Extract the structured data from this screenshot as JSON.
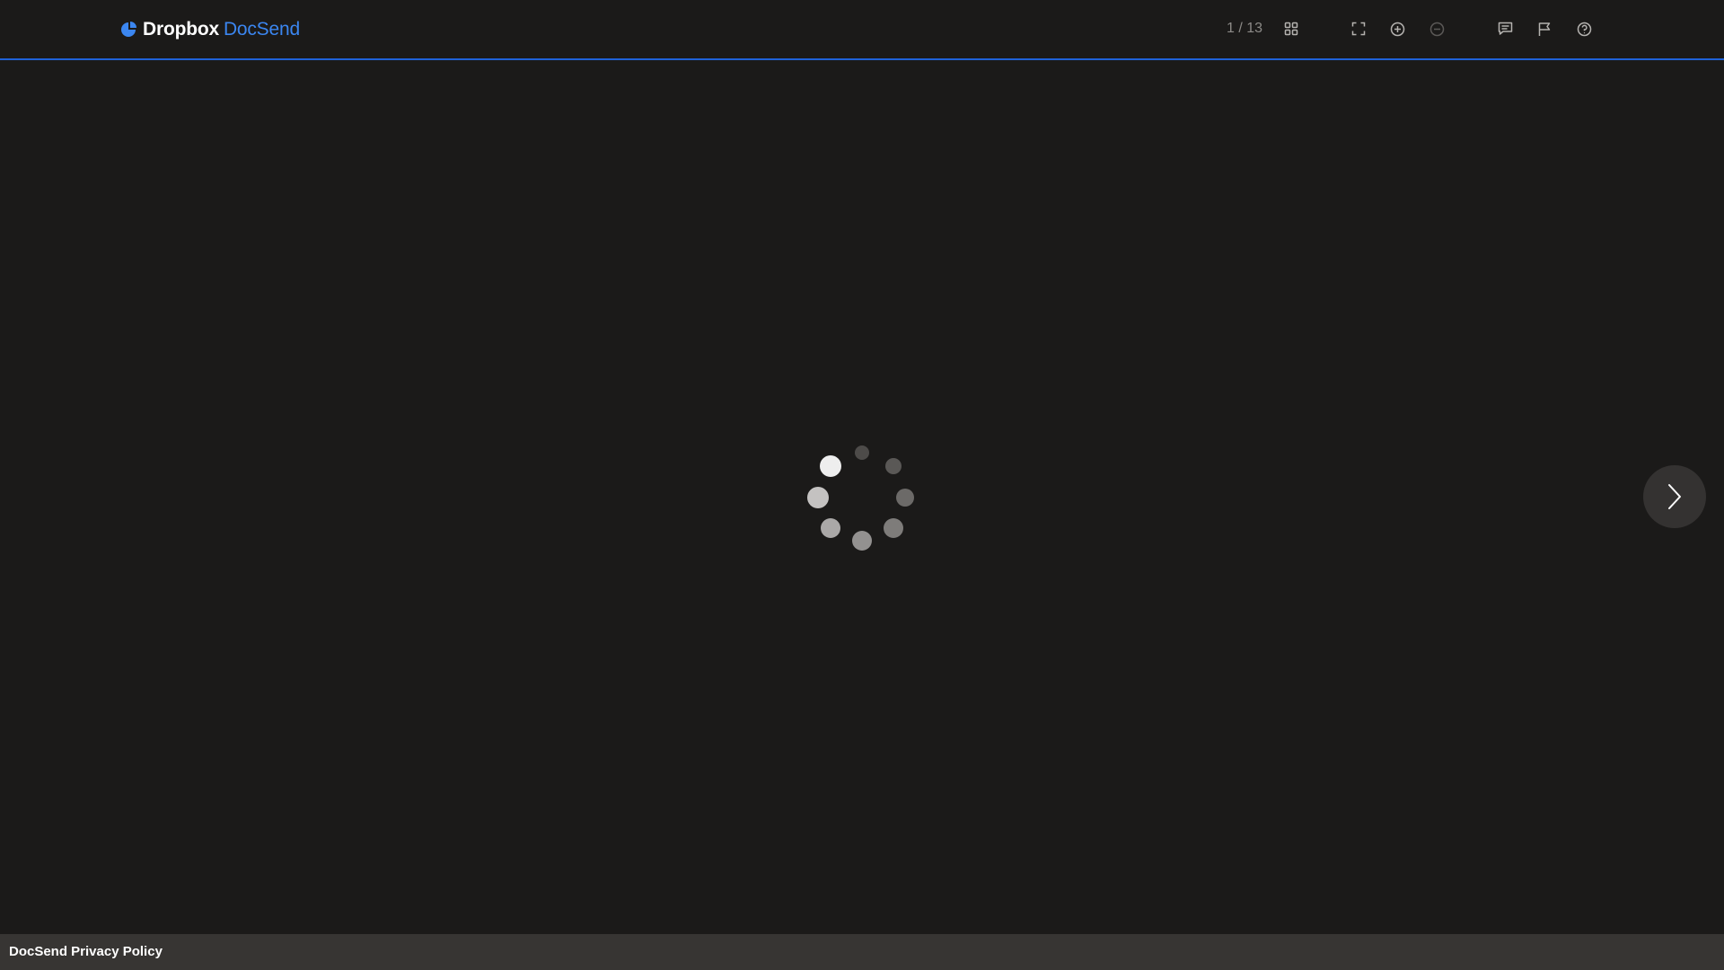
{
  "header": {
    "brand": {
      "name_part1": "Dropbox",
      "name_part2": "DocSend",
      "logo_icon": "docsend-logo-icon"
    },
    "page_counter": "1 / 13",
    "toolbar_icons": [
      "grid-view-icon",
      "fullscreen-icon",
      "zoom-in-icon",
      "zoom-out-icon",
      "comment-icon",
      "flag-icon",
      "help-icon"
    ]
  },
  "main": {
    "loading_indicator": "loading-spinner",
    "next_button_icon": "chevron-right-icon"
  },
  "footer": {
    "privacy_link": "DocSend Privacy Policy"
  },
  "colors": {
    "background": "#1b1a19",
    "accent": "#3b86f0",
    "divider": "#1f62d8",
    "footer_bg": "#373533",
    "icon": "#b5b3b0",
    "icon_disabled": "#5b5957"
  }
}
